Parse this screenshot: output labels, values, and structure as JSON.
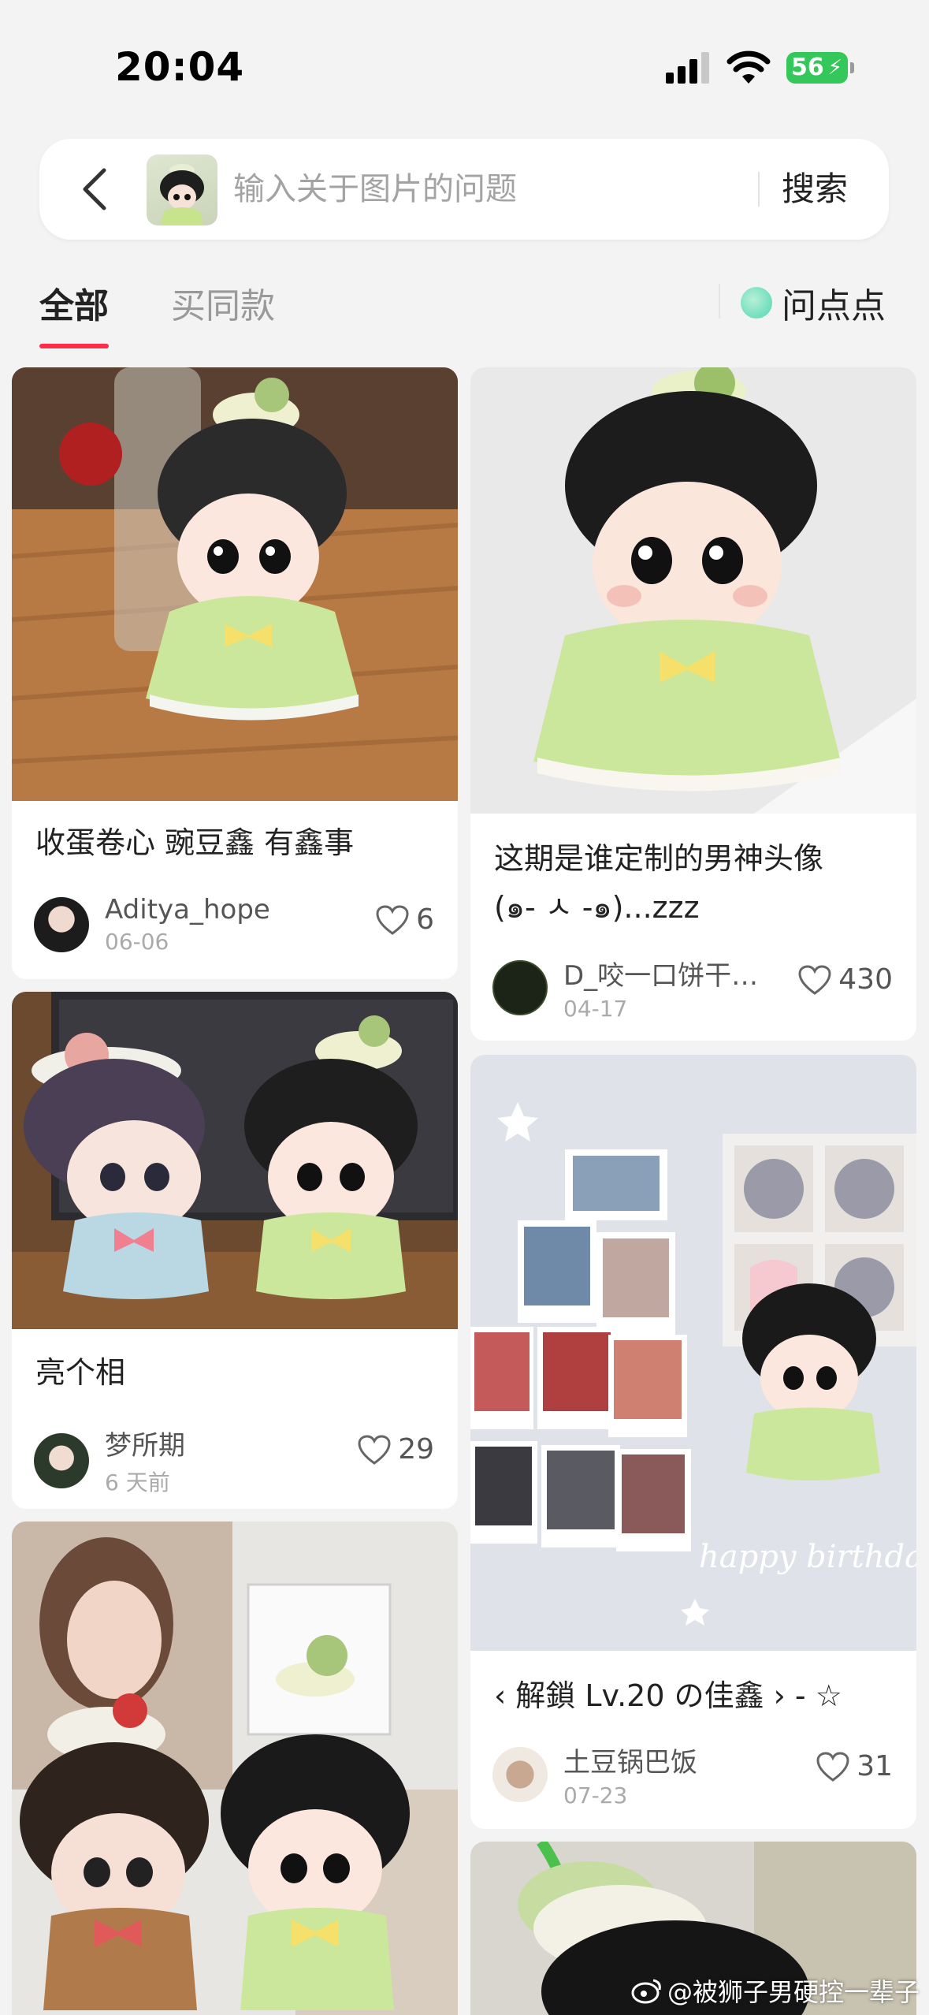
{
  "status_bar": {
    "time": "20:04",
    "battery": "56"
  },
  "search": {
    "placeholder": "输入关于图片的问题",
    "button": "搜索"
  },
  "tabs": {
    "all": "全部",
    "same_style": "买同款",
    "ask": "问点点"
  },
  "cards": [
    {
      "title": "收蛋卷心 豌豆鑫 有鑫事",
      "author": "Aditya_hope",
      "date": "06-06",
      "likes": "6"
    },
    {
      "title": "这期是谁定制的男神头像",
      "title2": "(๑- ㅅ -๑)...zzz",
      "author": "D_咬一口饼干…",
      "date": "04-17",
      "likes": "430"
    },
    {
      "title": "亮个相",
      "author": "梦所期",
      "date": "6 天前",
      "likes": "29"
    },
    {
      "title": "‹ 解鎖 Lv.20 の佳鑫 › - ☆",
      "author": "土豆锅巴饭",
      "date": "07-23",
      "likes": "31"
    }
  ],
  "watermark": "@被狮子男硬控一辈子"
}
